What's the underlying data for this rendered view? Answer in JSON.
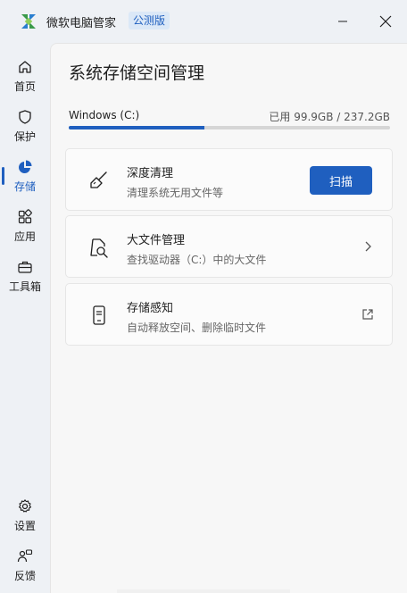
{
  "window": {
    "app_title": "微软电脑管家",
    "badge": "公测版"
  },
  "sidebar": {
    "items": [
      {
        "label": "首页",
        "icon": "home-icon"
      },
      {
        "label": "保护",
        "icon": "shield-icon"
      },
      {
        "label": "存储",
        "icon": "pie-chart-icon",
        "active": true
      },
      {
        "label": "应用",
        "icon": "apps-grid-icon"
      },
      {
        "label": "工具箱",
        "icon": "toolbox-icon"
      }
    ],
    "bottom": [
      {
        "label": "设置",
        "icon": "gear-icon"
      },
      {
        "label": "反馈",
        "icon": "feedback-icon"
      }
    ]
  },
  "main": {
    "title": "系统存储空间管理",
    "drive": {
      "name": "Windows (C:)",
      "usage_text": "已用 99.9GB / 237.2GB",
      "used_fraction": 0.421
    },
    "cards": [
      {
        "title": "深度清理",
        "subtitle": "清理系统无用文件等",
        "icon": "broom-icon",
        "button": "扫描"
      },
      {
        "title": "大文件管理",
        "subtitle": "查找驱动器（C:）中的大文件",
        "icon": "file-search-icon"
      },
      {
        "title": "存储感知",
        "subtitle": "自动释放空间、删除临时文件",
        "icon": "phone-storage-icon"
      }
    ]
  },
  "colors": {
    "accent": "#1f5fbf",
    "background": "#eef1f5",
    "card": "#fbfbfb"
  }
}
